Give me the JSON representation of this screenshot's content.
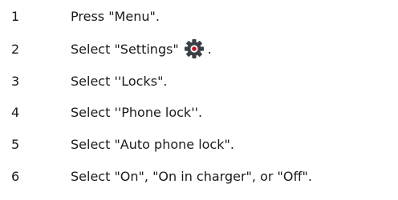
{
  "steps": [
    {
      "number": "1",
      "text": "Press \"Menu\"."
    },
    {
      "number": "2",
      "text": "Select \"Settings\"",
      "icon": "gear-icon",
      "suffix": "."
    },
    {
      "number": "3",
      "text": "Select ''Locks\"."
    },
    {
      "number": "4",
      "text": "Select ''Phone lock''."
    },
    {
      "number": "5",
      "text": "Select \"Auto phone lock\"."
    },
    {
      "number": "6",
      "text": "Select \"On\", \"On in charger\", or \"Off\"."
    }
  ],
  "colors": {
    "text": "#1a1a1a",
    "gear": "#3b3f46",
    "gear_center": "#c8102e"
  }
}
